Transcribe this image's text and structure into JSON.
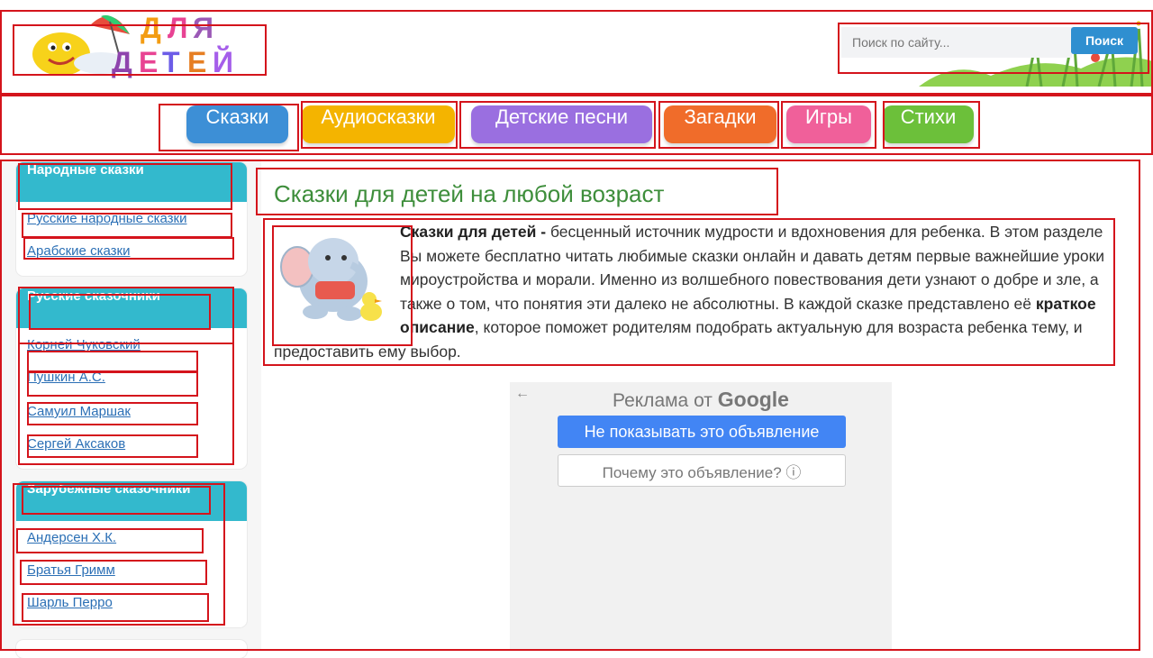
{
  "header": {
    "logo_text": "ДЛЯ ДЕТЕЙ",
    "search_placeholder": "Поиск по сайту...",
    "search_button": "Поиск"
  },
  "nav": [
    {
      "label": "Сказки",
      "color": "#3d8fd6"
    },
    {
      "label": "Аудиосказки",
      "color": "#f4b400"
    },
    {
      "label": "Детские песни",
      "color": "#9a6fe0"
    },
    {
      "label": "Загадки",
      "color": "#f06c2a"
    },
    {
      "label": "Игры",
      "color": "#f0609a"
    },
    {
      "label": "Стихи",
      "color": "#6cc03a"
    }
  ],
  "sidebar": {
    "sections": [
      {
        "title": "Народные сказки",
        "items": [
          "Русские народные сказки",
          "Арабские сказки"
        ]
      },
      {
        "title": "Русские сказочники",
        "items": [
          "Корней Чуковский",
          "Пушкин А.С.",
          "Самуил Маршак",
          "Сергей Аксаков"
        ]
      },
      {
        "title": "Зарубежные сказочники",
        "items": [
          "Андерсен Х.К.",
          "Братья Гримм",
          "Шарль Перро"
        ]
      }
    ]
  },
  "main": {
    "title": "Сказки для детей на любой возраст",
    "intro_bold1": "Сказки для детей -",
    "intro_text1": " бесценный источник мудрости и вдохновения для ребенка. В этом разделе Вы можете бесплатно читать любимые сказки онлайн и давать детям первые важнейшие уроки мироустройства и морали. Именно из волшебного повествования дети узнают о добре и зле, а также о том, что понятия эти далеко не абсолютны. В каждой сказке представлено её ",
    "intro_bold2": "краткое описание",
    "intro_text2": ", которое поможет родителям подобрать актуальную для возраста ребенка тему, и предоставить ему выбор."
  },
  "ad": {
    "back_arrow": "←",
    "title_prefix": "Реклама от ",
    "title_brand": "Google",
    "hide_button": "Не показывать это объявление",
    "why_button": "Почему это объявление? ⓘ"
  },
  "colors": {
    "accent": "#33b9cd",
    "title_green": "#3e8e3b",
    "link_blue": "#2b6fb5",
    "annotation_red": "#d4141c"
  }
}
